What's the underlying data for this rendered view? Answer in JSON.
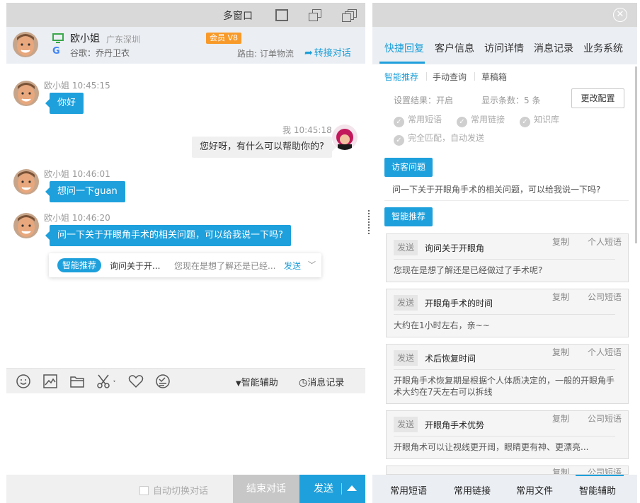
{
  "left_window": {
    "title": "多窗口"
  },
  "visitor": {
    "name": "欧小姐",
    "region": "广东深圳",
    "source": "谷歌：乔丹卫衣",
    "vip_label": "会员 V8",
    "route": "路由: 订单物流",
    "transfer_label": "转接对话"
  },
  "messages": [
    {
      "sender": "欧小姐",
      "time": "10:45:15",
      "text": "你好",
      "direction": "in"
    },
    {
      "sender": "我",
      "time": "10:45:18",
      "text": "您好呀，有什么可以帮助你的?",
      "direction": "out"
    },
    {
      "sender": "欧小姐",
      "time": "10:46:01",
      "text": "想问一下guan",
      "direction": "in"
    },
    {
      "sender": "欧小姐",
      "time": "10:46:20",
      "text": "问一下关于开眼角手术的相关问题，可以给我说一下吗?",
      "direction": "in"
    }
  ],
  "smart_popup": {
    "pill": "智能推荐",
    "title": "询问关于开...",
    "preview": "您现在是想了解还是已经...",
    "send": "发送"
  },
  "toolbar": {
    "assist_label": "智能辅助",
    "history_label": "消息记录"
  },
  "bottom": {
    "auto_switch": "自动切换对话",
    "end_chat": "结束对话",
    "send": "发送"
  },
  "right_panel": {
    "tabs": [
      "快捷回复",
      "客户信息",
      "访问详情",
      "消息记录",
      "业务系统"
    ],
    "sub_tabs": [
      "智能推荐",
      "手动查询",
      "草稿箱"
    ],
    "settings": {
      "result": "设置结果：开启",
      "count": "显示条数：5  条",
      "config_button": "更改配置",
      "checks": [
        "常用短语",
        "常用链接",
        "知识库",
        "完全匹配，自动发送"
      ]
    },
    "visitor_q_label": "访客问题",
    "visitor_q": "问一下关于开眼角手术的相关问题，可以给我说一下吗?",
    "recommend_label": "智能推荐",
    "cards": [
      {
        "send": "发送",
        "title": "询问关于开眼角",
        "copy": "复制",
        "type": "个人短语",
        "body": "您现在是想了解还是已经做过了手术呢?"
      },
      {
        "send": "发送",
        "title": "开眼角手术的时间",
        "copy": "复制",
        "type": "公司短语",
        "body": "大约在1小时左右，亲~~"
      },
      {
        "send": "发送",
        "title": "术后恢复时间",
        "copy": "复制",
        "type": "个人短语",
        "body": "开眼角手术恢复期是根据个人体质决定的，一般的开眼角手术大约在7天左右可以拆线"
      },
      {
        "send": "发送",
        "title": "开眼角手术优势",
        "copy": "复制",
        "type": "公司短语",
        "body": "开眼角术可以让视线更开阔，眼睛更有神、更漂亮..."
      },
      {
        "send": "",
        "title": "",
        "copy": "复制",
        "type": "公司短语",
        "body": ""
      }
    ],
    "bottom_tabs": [
      "常用短语",
      "常用链接",
      "常用文件",
      "智能辅助"
    ]
  },
  "colors": {
    "accent": "#1ea0dc",
    "vip": "#f89a2a",
    "titlebar": "#d9d9d9",
    "header_bg": "#ebeef3"
  }
}
